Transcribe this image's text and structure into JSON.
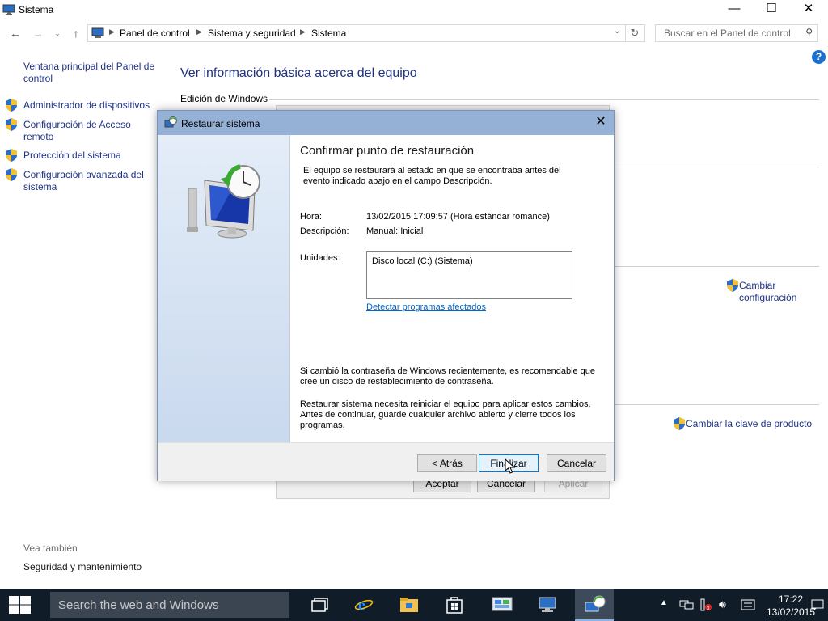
{
  "window": {
    "title": "Sistema",
    "minimize": "—",
    "maximize": "☐",
    "close": "✕"
  },
  "address": {
    "crumbs": [
      "Panel de control",
      "Sistema y seguridad",
      "Sistema"
    ],
    "search_placeholder": "Buscar en el Panel de control"
  },
  "help_label": "?",
  "left_pane": {
    "home_link": "Ventana principal del Panel de control",
    "links": [
      "Administrador de dispositivos",
      "Configuración de Acceso remoto",
      "Protección del sistema",
      "Configuración avanzada del sistema"
    ],
    "see_also_title": "Vea también",
    "see_also_links": [
      "Seguridad y mantenimiento"
    ]
  },
  "main": {
    "title": "Ver información básica acerca del equipo",
    "section_windows_edition": "Edición de Windows",
    "change_settings": "Cambiar configuración",
    "change_product_key": "Cambiar la clave de producto"
  },
  "background_dialog": {
    "ok": "Aceptar",
    "cancel": "Cancelar",
    "apply": "Aplicar"
  },
  "restore_dialog": {
    "title": "Restaurar sistema",
    "heading": "Confirmar punto de restauración",
    "intro": "El equipo se restaurará al estado en que se encontraba antes del evento indicado abajo en el campo Descripción.",
    "time_label": "Hora:",
    "time_value": "13/02/2015 17:09:57 (Hora estándar romance)",
    "description_label": "Descripción:",
    "description_value": "Manual: Inicial",
    "units_label": "Unidades:",
    "units_value": "Disco local (C:) (Sistema)",
    "detect_link": "Detectar programas afectados",
    "password_note": "Si cambió la contraseña de Windows recientemente, es recomendable que cree un disco de restablecimiento de contraseña.",
    "restart_note": "Restaurar sistema necesita reiniciar el equipo para aplicar estos cambios. Antes de continuar, guarde cualquier archivo abierto y cierre todos los programas.",
    "back_button": "< Atrás",
    "finish_button": "Finalizar",
    "cancel_button": "Cancelar"
  },
  "taskbar": {
    "search_placeholder": "Search the web and Windows",
    "time": "17:22",
    "date": "13/02/2015"
  }
}
